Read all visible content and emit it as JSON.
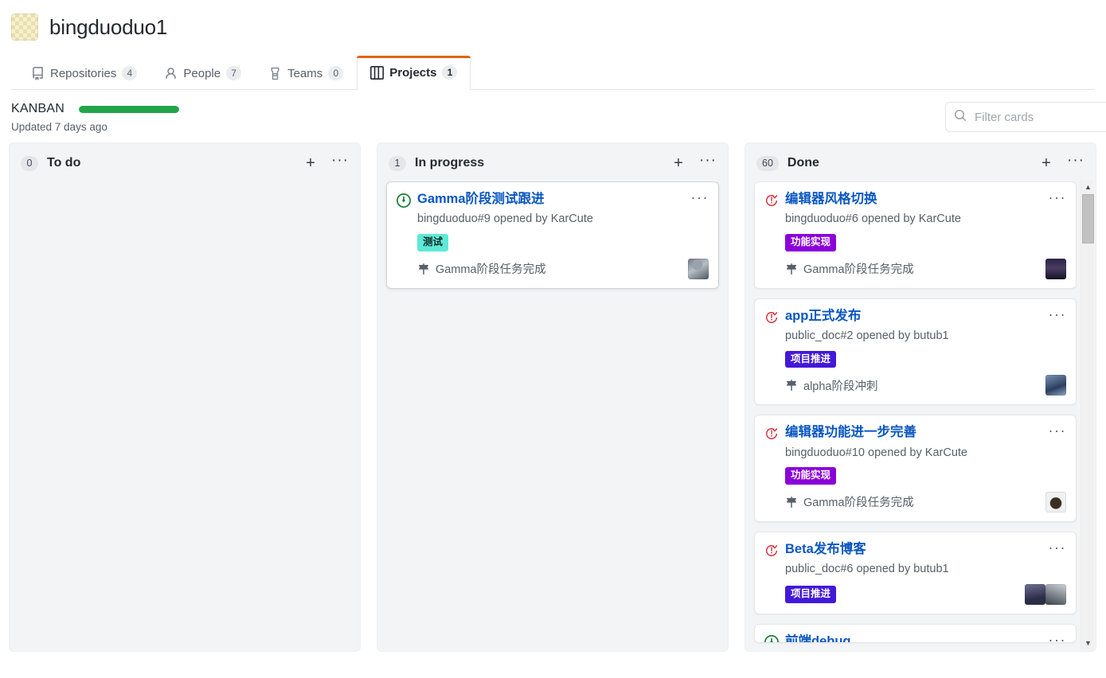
{
  "org": {
    "name": "bingduoduo1",
    "avatar_icon": "checkerboard-avatar"
  },
  "tabs": [
    {
      "label": "Repositories",
      "count": "4",
      "icon": "repo-icon",
      "selected": false
    },
    {
      "label": "People",
      "count": "7",
      "icon": "person-icon",
      "selected": false
    },
    {
      "label": "Teams",
      "count": "0",
      "icon": "team-icon",
      "selected": false
    },
    {
      "label": "Projects",
      "count": "1",
      "icon": "project-board-icon",
      "selected": true
    }
  ],
  "project": {
    "name": "KANBAN",
    "updated": "Updated 7 days ago",
    "progress_percent": 100,
    "progress_color": "#22a44a",
    "accent_color": "#e36209"
  },
  "filter": {
    "placeholder": "Filter cards",
    "value": "",
    "icon": "search-icon"
  },
  "columns": [
    {
      "title": "To do",
      "count": "0",
      "add_label": "+",
      "menu_label": "···",
      "cards": []
    },
    {
      "title": "In progress",
      "count": "1",
      "add_label": "+",
      "menu_label": "···",
      "cards": [
        {
          "state": "open",
          "state_icon": "issue-opened-icon",
          "state_color": "#1a7f37",
          "title": "Gamma阶段测试跟进",
          "meta": "bingduoduo#9 opened by KarCute",
          "repo": "bingduoduo",
          "number": "#9",
          "author": "KarCute",
          "labels": [
            {
              "text": "测试",
              "bg": "#5ee9d7",
              "fg": "#0d2b26"
            }
          ],
          "milestone": "Gamma阶段任务完成",
          "milestone_icon": "milestone-icon",
          "avatars": [
            "av-karcute"
          ]
        }
      ]
    },
    {
      "title": "Done",
      "count": "60",
      "add_label": "+",
      "menu_label": "···",
      "scrollbar": {
        "up_arrow": "▲",
        "down_arrow": "▼"
      },
      "cards": [
        {
          "state": "closed",
          "state_icon": "issue-closed-icon",
          "state_color": "#cf222e",
          "title": "编辑器风格切换",
          "meta": "bingduoduo#6 opened by KarCute",
          "repo": "bingduoduo",
          "number": "#6",
          "author": "KarCute",
          "labels": [
            {
              "text": "功能实现",
              "bg": "#8b00d9",
              "fg": "#ffffff"
            }
          ],
          "milestone": "Gamma阶段任务完成",
          "milestone_icon": "milestone-icon",
          "avatars": [
            "av-mountain"
          ]
        },
        {
          "state": "closed",
          "state_icon": "issue-closed-icon",
          "state_color": "#cf222e",
          "title": "app正式发布",
          "meta": "public_doc#2 opened by butub1",
          "repo": "public_doc",
          "number": "#2",
          "author": "butub1",
          "labels": [
            {
              "text": "项目推进",
              "bg": "#4318d9",
              "fg": "#ffffff"
            }
          ],
          "milestone": "alpha阶段冲刺",
          "milestone_icon": "milestone-icon",
          "avatars": [
            "av-blue"
          ]
        },
        {
          "state": "closed",
          "state_icon": "issue-closed-icon",
          "state_color": "#cf222e",
          "title": "编辑器功能进一步完善",
          "meta": "bingduoduo#10 opened by KarCute",
          "repo": "bingduoduo",
          "number": "#10",
          "author": "KarCute",
          "labels": [
            {
              "text": "功能实现",
              "bg": "#8b00d9",
              "fg": "#ffffff"
            }
          ],
          "milestone": "Gamma阶段任务完成",
          "milestone_icon": "milestone-icon",
          "avatars": [
            "av-dark"
          ]
        },
        {
          "state": "closed",
          "state_icon": "issue-closed-icon",
          "state_color": "#cf222e",
          "title": "Beta发布博客",
          "meta": "public_doc#6 opened by butub1",
          "repo": "public_doc",
          "number": "#6",
          "author": "butub1",
          "labels": [
            {
              "text": "项目推进",
              "bg": "#4318d9",
              "fg": "#ffffff"
            }
          ],
          "milestone": "",
          "milestone_icon": "",
          "avatars": [
            "av-p1",
            "av-p2"
          ]
        },
        {
          "state": "open",
          "state_icon": "issue-opened-icon",
          "state_color": "#1a7f37",
          "title": "前端debug",
          "meta": "",
          "repo": "",
          "number": "",
          "author": "",
          "labels": [],
          "milestone": "",
          "milestone_icon": "",
          "avatars": [],
          "clipped": true
        }
      ]
    }
  ]
}
